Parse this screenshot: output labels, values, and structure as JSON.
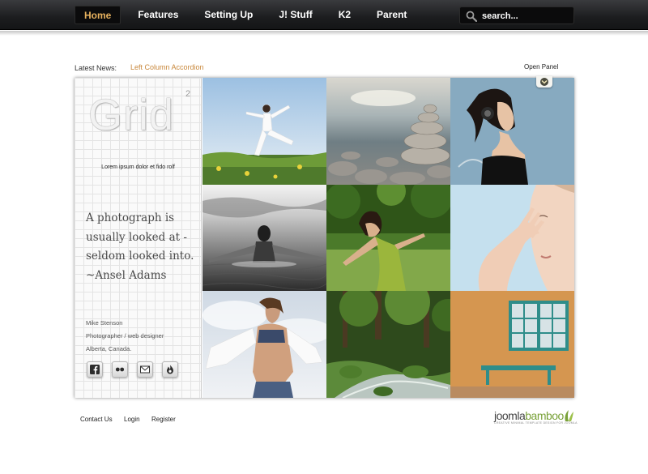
{
  "nav": {
    "items": [
      {
        "label": "Home",
        "active": true
      },
      {
        "label": "Features",
        "active": false
      },
      {
        "label": "Setting Up",
        "active": false
      },
      {
        "label": "J! Stuff",
        "active": false
      },
      {
        "label": "K2",
        "active": false
      },
      {
        "label": "Parent",
        "active": false
      }
    ],
    "search_placeholder": "search..."
  },
  "news": {
    "label": "Latest News:",
    "item": "Left Column Accordion",
    "open_panel": "Open Panel"
  },
  "sidebar": {
    "logo": "Grid",
    "logo_sup": "2",
    "tagline": "Lorem ipsum dolor et fido rolf",
    "quote": [
      "A photograph is",
      "usually looked at -",
      "seldom looked into.",
      "~Ansel Adams"
    ],
    "author": [
      "Mike Stenson",
      "Photographer / web designer",
      "Alberta, Canada."
    ],
    "social_icons": [
      "facebook-icon",
      "flickr-icon",
      "mail-icon",
      "feed-icon"
    ]
  },
  "photos": [
    "dancer-on-grass-photo",
    "stacked-stones-photo",
    "woman-headphones-photo",
    "woman-in-water-photo",
    "woman-in-forest-photo",
    "woman-face-hand-photo",
    "woman-sky-shirt-photo",
    "forest-stream-photo",
    "adobe-wall-bench-photo"
  ],
  "footer": {
    "links": [
      "Contact Us",
      "Login",
      "Register"
    ],
    "brand_a": "joomla",
    "brand_b": "bamboo",
    "brand_sub": "CREATIVE MINIMAL TEMPLATE DESIGN FOR JOOMLA",
    "brand_color": "#7aa23a"
  },
  "colors": {
    "accent": "#e6b15e",
    "news_link": "#c8873a",
    "navbar": "#1c1d1f"
  }
}
